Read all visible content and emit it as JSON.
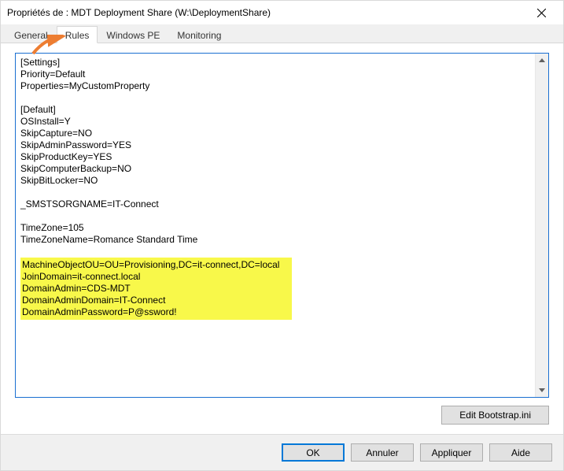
{
  "window": {
    "title": "Propriétés de : MDT Deployment Share (W:\\DeploymentShare)"
  },
  "tabs": {
    "general": "General",
    "rules": "Rules",
    "windows_pe": "Windows PE",
    "monitoring": "Monitoring",
    "active": "rules"
  },
  "rules_editor": {
    "block1": "[Settings]\nPriority=Default\nProperties=MyCustomProperty",
    "block2": "[Default]\nOSInstall=Y\nSkipCapture=NO\nSkipAdminPassword=YES\nSkipProductKey=YES\nSkipComputerBackup=NO\nSkipBitLocker=NO",
    "block3": "_SMSTSORGNAME=IT-Connect",
    "block4": "TimeZone=105\nTimeZoneName=Romance Standard Time",
    "highlight": "MachineObjectOU=OU=Provisioning,DC=it-connect,DC=local\nJoinDomain=it-connect.local\nDomainAdmin=CDS-MDT\nDomainAdminDomain=IT-Connect\nDomainAdminPassword=P@ssword!"
  },
  "buttons": {
    "edit_bootstrap": "Edit Bootstrap.ini",
    "ok": "OK",
    "cancel": "Annuler",
    "apply": "Appliquer",
    "help": "Aide"
  },
  "colors": {
    "highlight_bg": "#f8f84a",
    "focus_border": "#0078d7",
    "arrow": "#ed7d31"
  }
}
